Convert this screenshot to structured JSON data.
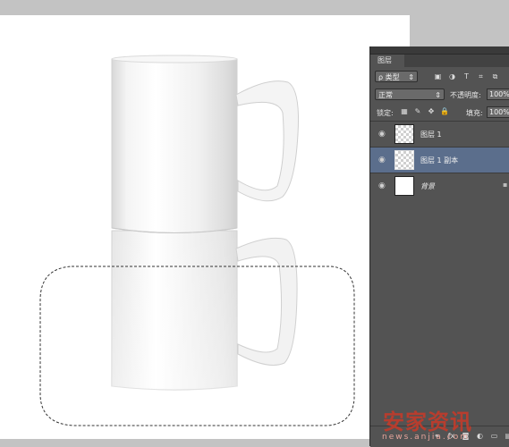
{
  "layers_panel": {
    "tab_label": "图层",
    "filter": {
      "selected": "类型",
      "search_glyph": "ρ",
      "icons": [
        "image-filter-icon",
        "adjustment-filter-icon",
        "type-filter-icon",
        "shape-filter-icon",
        "smart-object-filter-icon"
      ],
      "icon_glyphs": [
        "▣",
        "◑",
        "T",
        "⌗",
        "⧉"
      ]
    },
    "blend_mode": "正常",
    "opacity_label": "不透明度:",
    "opacity_value": "100%",
    "lock_label": "锁定:",
    "lock_icon_glyphs": [
      "▦",
      "✎",
      "✥",
      "🔒"
    ],
    "fill_label": "填充:",
    "fill_value": "100%",
    "layers": [
      {
        "name": "图层 1",
        "selected": false,
        "thumbnail": "transparent"
      },
      {
        "name": "图层 1 副本",
        "selected": true,
        "thumbnail": "transparent"
      },
      {
        "name": "背景",
        "selected": false,
        "thumbnail": "white",
        "locked": true
      }
    ],
    "bottom_icon_glyphs": [
      "⚭",
      "ƒx",
      "◙",
      "◐",
      "▭",
      "▤",
      "🗑"
    ]
  },
  "watermark": {
    "text": "安家资讯",
    "url": "news.anjia.com"
  },
  "colors": {
    "panel_bg": "#535353",
    "selected_layer": "#5b6e8c",
    "workspace": "#c3c3c3",
    "watermark": "#c23b2b"
  }
}
